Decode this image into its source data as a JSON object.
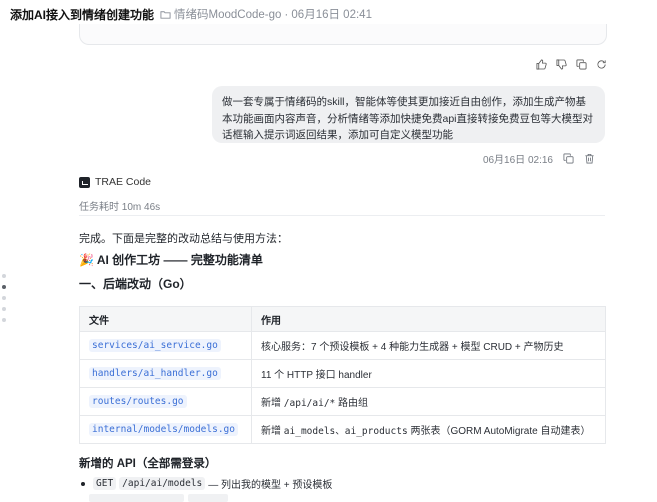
{
  "header": {
    "title": "添加AI接入到情绪创建功能",
    "project": "情绪码MoodCode-go",
    "separator": "·",
    "timestamp": "06月16日 02:41"
  },
  "user_message": {
    "text": "做一套专属于情绪码的skill，智能体等使其更加接近自由创作，添加生成产物基本功能画面内容声音，分析情绪等添加快捷免费api直接转接免费豆包等大模型对话框输入提示词返回结果，添加可自定义模型功能",
    "time": "06月16日 02:16"
  },
  "agent": {
    "name": "TRAE Code",
    "elapsed": "任务耗时 10m 46s",
    "intro": "完成。下面是完整的改动总结与使用方法：",
    "feature_heading": "🎉 AI 创作工坊 —— 完整功能清单",
    "backend_heading": "一、后端改动（Go）",
    "table": {
      "headers": [
        "文件",
        "作用"
      ],
      "rows": [
        {
          "file": "services/ai_service.go",
          "desc_before": "",
          "desc_code": "",
          "desc_after": "核心服务：7 个预设模板 + 4 种能力生成器 + 模型 CRUD + 产物历史"
        },
        {
          "file": "handlers/ai_handler.go",
          "desc_before": "",
          "desc_code": "",
          "desc_after": "11 个 HTTP 接口 handler"
        },
        {
          "file": "routes/routes.go",
          "desc_before": "新增 ",
          "desc_code": "/api/ai/*",
          "desc_after": " 路由组"
        },
        {
          "file": "internal/models/models.go",
          "desc_before": "新增 ",
          "desc_code": "ai_models、ai_products",
          "desc_after": " 两张表（GORM AutoMigrate 自动建表）"
        }
      ]
    },
    "api_heading": "新增的 API（全部需登录）",
    "api_items": [
      {
        "method": "GET",
        "path": "/api/ai/models",
        "desc": "— 列出我的模型 + 预设模板"
      }
    ]
  },
  "icons": [
    "folder-icon",
    "thumbs-up-icon",
    "thumbs-down-icon",
    "copy-icon",
    "refresh-icon",
    "delete-icon",
    "trae-logo-icon"
  ]
}
